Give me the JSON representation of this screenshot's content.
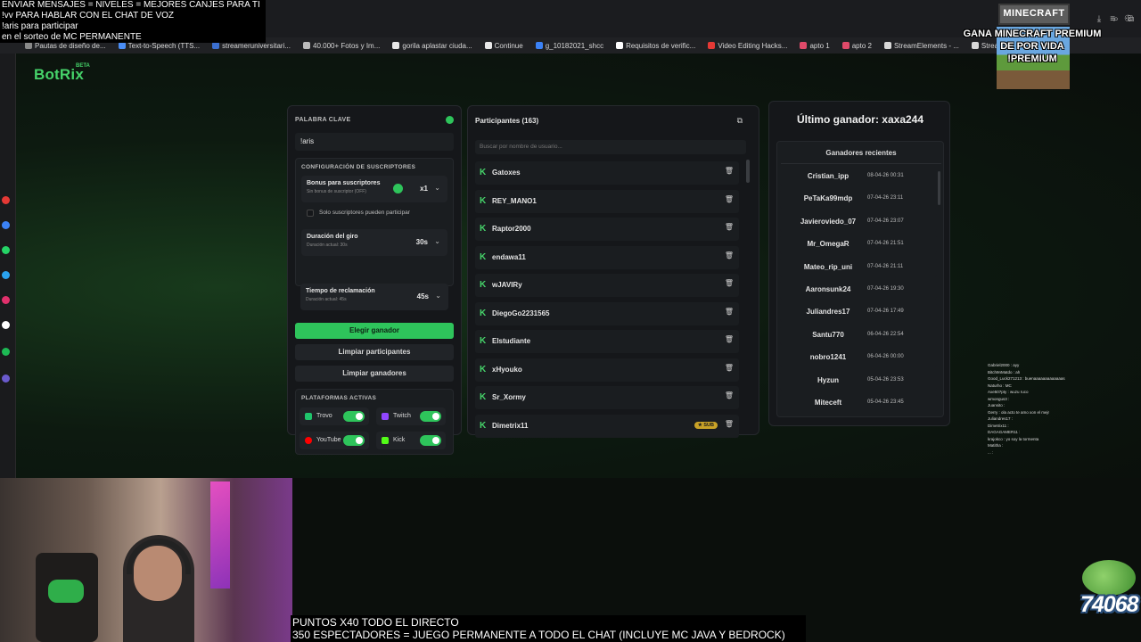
{
  "browser": {
    "bookmarks": [
      {
        "label": "Pautas de diseño de...",
        "color": "#8a8a8a"
      },
      {
        "label": "Text-to-Speech (TTS...",
        "color": "#4a8df6"
      },
      {
        "label": "streameruniversitari...",
        "color": "#3b6fd0"
      },
      {
        "label": "40.000+ Fotos y Im...",
        "color": "#bbbbbb"
      },
      {
        "label": "gorila aplastar ciuda...",
        "color": "#e8e8e8"
      },
      {
        "label": "Continue",
        "color": "#e8e8e8"
      },
      {
        "label": "g_10182021_shcc",
        "color": "#3b82f6"
      },
      {
        "label": "Requisitos de verific...",
        "color": "#ffffff"
      },
      {
        "label": "Video Editing Hacks...",
        "color": "#e53935"
      },
      {
        "label": "apto 1",
        "color": "#e04a6a"
      },
      {
        "label": "apto 2",
        "color": "#e04a6a"
      },
      {
        "label": "StreamElements - ...",
        "color": "#d8d8d8"
      },
      {
        "label": "Streame...",
        "color": "#d8d8d8"
      }
    ]
  },
  "app": {
    "logo": "BotRix",
    "logo_badge": "BETA"
  },
  "settings": {
    "keyword_label": "PALABRA CLAVE",
    "keyword_value": "!aris",
    "subscribers_header": "CONFIGURACIÓN DE SUSCRIPTORES",
    "bonus_title": "Bonus para suscriptores",
    "bonus_sub": "Sin bonus de suscriptor (OFF)",
    "bonus_value": "x1",
    "subs_only_label": "Solo suscriptores pueden participar",
    "spin_title": "Duración del giro",
    "spin_sub": "Duración actual: 30s",
    "spin_value": "30s",
    "claim_title": "Tiempo de reclamación",
    "claim_sub": "Duración actual: 45s",
    "claim_value": "45s",
    "pick_winner": "Elegir ganador",
    "clear_participants": "Limpiar participantes",
    "clear_winners": "Limpiar ganadores",
    "platforms_header": "PLATAFORMAS ACTIVAS",
    "platforms": [
      {
        "name": "Trovo",
        "color": "#1fc46b"
      },
      {
        "name": "Twitch",
        "color": "#9146ff"
      },
      {
        "name": "YouTube",
        "color": "#ff0000"
      },
      {
        "name": "Kick",
        "color": "#53fc18"
      }
    ]
  },
  "participants": {
    "title": "Participantes (163)",
    "search_placeholder": "Buscar por nombre de usuario...",
    "list": [
      {
        "name": "Gatoxes",
        "sub": ""
      },
      {
        "name": "REY_MANO1",
        "sub": ""
      },
      {
        "name": "Raptor2000",
        "sub": ""
      },
      {
        "name": "endawa11",
        "sub": ""
      },
      {
        "name": "wJAVIRy",
        "sub": ""
      },
      {
        "name": "DiegoGo2231565",
        "sub": ""
      },
      {
        "name": "Elstudiante",
        "sub": ""
      },
      {
        "name": "xHyouko",
        "sub": ""
      },
      {
        "name": "Sr_Xormy",
        "sub": ""
      },
      {
        "name": "Dimetrix11",
        "sub": "★ SUB"
      }
    ]
  },
  "winners": {
    "last_winner": "Último ganador: xaxa244",
    "recent_title": "Ganadores recientes",
    "list": [
      {
        "name": "Cristian_ipp",
        "date": "08-04-26 00:31"
      },
      {
        "name": "PeTaKa99mdp",
        "date": "07-04-26 23:11"
      },
      {
        "name": "Javieroviedo_07",
        "date": "07-04-26 23:07"
      },
      {
        "name": "Mr_OmegaR",
        "date": "07-04-26 21:51"
      },
      {
        "name": "Mateo_rip_uni",
        "date": "07-04-26 21:11"
      },
      {
        "name": "Aaronsunk24",
        "date": "07-04-26 19:30"
      },
      {
        "name": "Juliandres17",
        "date": "07-04-26 17:49"
      },
      {
        "name": "Santu770",
        "date": "06-04-26 22:54"
      },
      {
        "name": "nobro1241",
        "date": "06-04-26 00:00"
      },
      {
        "name": "Hyzun",
        "date": "05-04-26 23:53"
      },
      {
        "name": "Miteceft",
        "date": "05-04-26 23:45"
      }
    ]
  },
  "overlays": {
    "top_lines": [
      "ENVIAR MENSAJES = NIVELES = MEJORES CANJES PARA TI",
      "!vv PARA HABLAR CON EL CHAT DE VOZ",
      "!aris para participar",
      "en el sorteo de MC PERMANENTE"
    ],
    "bottom_lines": [
      "PUNTOS X40 TODO EL DIRECTO",
      "350 ESPECTADORES = JUEGO PERMANENTE A TODO EL CHAT (INCLUYE MC JAVA Y BEDROCK)"
    ],
    "mc_logo": "MINECRAFT",
    "mc_promo_lines": [
      "GANA MINECRAFT PREMIUM",
      "DE POR VIDA",
      "!PREMIUM"
    ],
    "counter": "74068",
    "chat_lines": [
      "Gabriel2000 : ayy",
      "Bitch9nMatdo : ah",
      "Good_Luck271213 : buenaaaaaaaaaaaaas",
      "Naturho : MC",
      "Axe507pty : wuzu ruco",
      "wmongus3 : ",
      "Juansito : ",
      "Gerry : ola acto te amo xon el mejr",
      "Juliandres17 : ",
      "Dimetrix11 : ",
      "DAGAGAMER11 : ",
      "krajokco : yo soy la tormenta",
      "Matitha : ",
      "...  : "
    ]
  }
}
